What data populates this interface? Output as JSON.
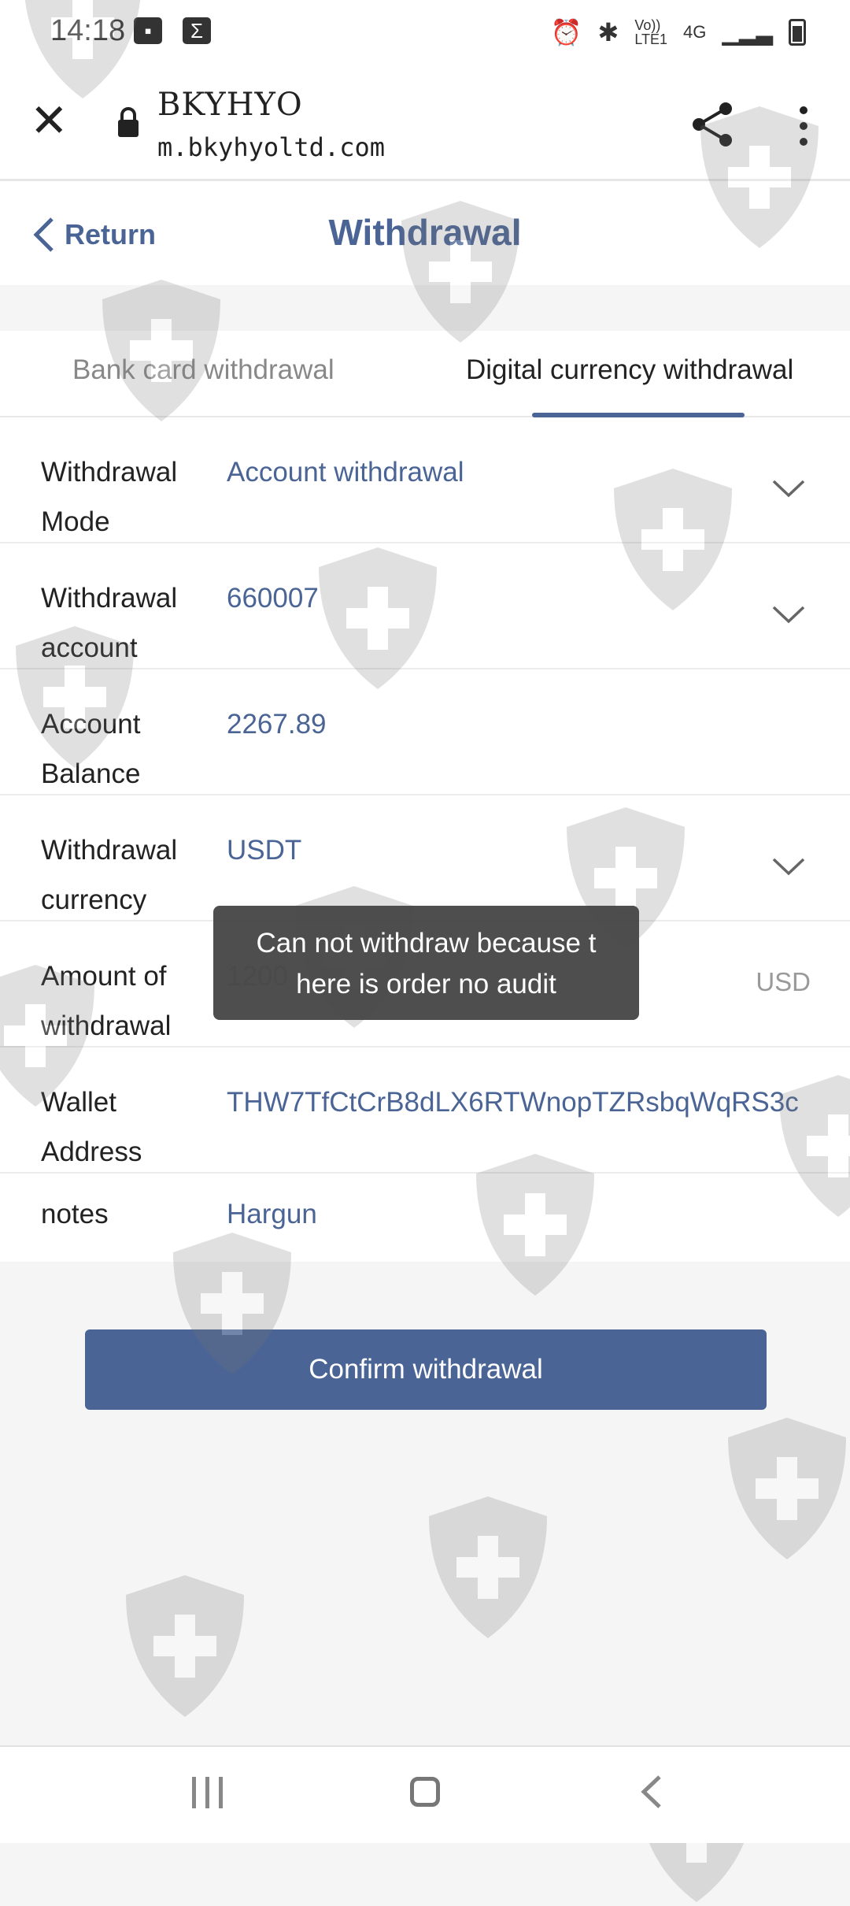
{
  "status_bar": {
    "time": "14:18",
    "left_icons": [
      "image-icon",
      "sigma-icon"
    ],
    "right_icons": [
      "alarm-icon",
      "bluetooth-icon",
      "volte-icon",
      "4g-icon",
      "signal-icon",
      "battery-icon"
    ],
    "volte_label": "Vo))\nLTE1",
    "network_label": "4G"
  },
  "browser": {
    "site_title": "BKYHYO",
    "url": "m.bkyhyoltd.com"
  },
  "header": {
    "return_label": "Return",
    "title": "Withdrawal"
  },
  "tabs": [
    {
      "label": "Bank card withdrawal",
      "active": false
    },
    {
      "label": "Digital currency withdrawal",
      "active": true
    }
  ],
  "form": {
    "withdrawal_mode": {
      "label": "Withdrawal Mode",
      "value": "Account withdrawal"
    },
    "withdrawal_account": {
      "label": "Withdrawal account",
      "value": "660007"
    },
    "account_balance": {
      "label": "Account Balance",
      "value": "2267.89"
    },
    "withdrawal_currency": {
      "label": "Withdrawal currency",
      "value": "USDT"
    },
    "amount": {
      "label": "Amount of withdrawal",
      "value": "1200",
      "unit": "USD"
    },
    "wallet_address": {
      "label": "Wallet Address",
      "value": "THW7TfCtCrB8dLX6RTWnopTZRsbqWqRS3c"
    },
    "notes": {
      "label": "notes",
      "value": "Hargun"
    }
  },
  "toast": {
    "message": "Can not withdraw because t here is order no audit"
  },
  "confirm_label": "Confirm withdrawal",
  "colors": {
    "accent": "#4a6495",
    "toast_bg": "#444444",
    "page_bg": "#f5f5f5"
  }
}
